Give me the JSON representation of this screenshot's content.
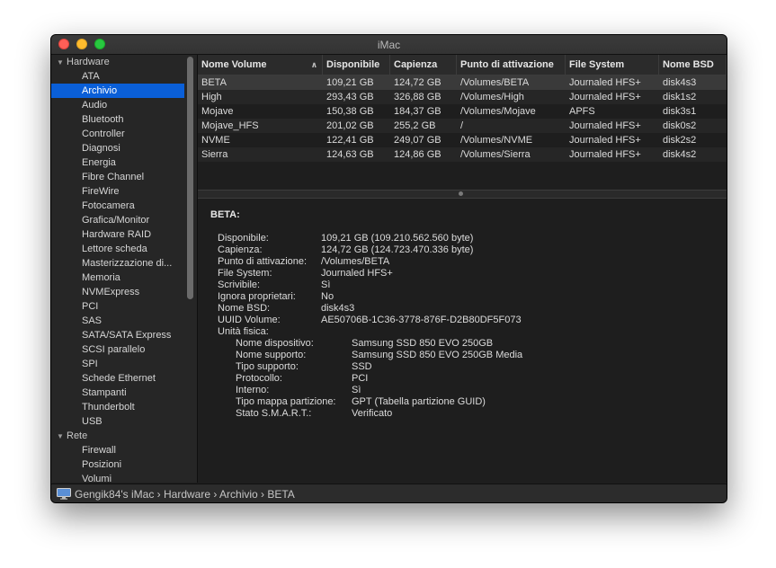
{
  "window": {
    "title": "iMac"
  },
  "sidebar": {
    "groups": [
      {
        "label": "Hardware",
        "items": [
          "ATA",
          "Archivio",
          "Audio",
          "Bluetooth",
          "Controller",
          "Diagnosi",
          "Energia",
          "Fibre Channel",
          "FireWire",
          "Fotocamera",
          "Grafica/Monitor",
          "Hardware RAID",
          "Lettore scheda",
          "Masterizzazione di...",
          "Memoria",
          "NVMExpress",
          "PCI",
          "SAS",
          "SATA/SATA Express",
          "SCSI parallelo",
          "SPI",
          "Schede Ethernet",
          "Stampanti",
          "Thunderbolt",
          "USB"
        ]
      },
      {
        "label": "Rete",
        "items": [
          "Firewall",
          "Posizioni",
          "Volumi"
        ]
      }
    ],
    "selected": "Archivio"
  },
  "table": {
    "columns": [
      "Nome Volume",
      "Disponibile",
      "Capienza",
      "Punto di attivazione",
      "File System",
      "Nome BSD"
    ],
    "rows": [
      [
        "BETA",
        "109,21 GB",
        "124,72 GB",
        "/Volumes/BETA",
        "Journaled HFS+",
        "disk4s3"
      ],
      [
        "High",
        "293,43 GB",
        "326,88 GB",
        "/Volumes/High",
        "Journaled HFS+",
        "disk1s2"
      ],
      [
        "Mojave",
        "150,38 GB",
        "184,37 GB",
        "/Volumes/Mojave",
        "APFS",
        "disk3s1"
      ],
      [
        "Mojave_HFS",
        "201,02 GB",
        "255,2 GB",
        "/",
        "Journaled HFS+",
        "disk0s2"
      ],
      [
        "NVME",
        "122,41 GB",
        "249,07 GB",
        "/Volumes/NVME",
        "Journaled HFS+",
        "disk2s2"
      ],
      [
        "Sierra",
        "124,63 GB",
        "124,86 GB",
        "/Volumes/Sierra",
        "Journaled HFS+",
        "disk4s2"
      ]
    ],
    "selected_row": 0
  },
  "detail": {
    "title": "BETA:",
    "fields": [
      [
        "Disponibile:",
        "109,21 GB (109.210.562.560 byte)"
      ],
      [
        "Capienza:",
        "124,72 GB (124.723.470.336 byte)"
      ],
      [
        "Punto di attivazione:",
        "/Volumes/BETA"
      ],
      [
        "File System:",
        "Journaled HFS+"
      ],
      [
        "Scrivibile:",
        "Sì"
      ],
      [
        "Ignora proprietari:",
        "No"
      ],
      [
        "Nome BSD:",
        "disk4s3"
      ],
      [
        "UUID Volume:",
        "AE50706B-1C36-3778-876F-D2B80DF5F073"
      ],
      [
        "Unità fisica:",
        ""
      ]
    ],
    "physical": [
      [
        "Nome dispositivo:",
        "Samsung SSD 850 EVO 250GB"
      ],
      [
        "Nome supporto:",
        "Samsung SSD 850 EVO 250GB Media"
      ],
      [
        "Tipo supporto:",
        "SSD"
      ],
      [
        "Protocollo:",
        "PCI"
      ],
      [
        "Interno:",
        "Sì"
      ],
      [
        "Tipo mappa partizione:",
        "GPT (Tabella partizione GUID)"
      ],
      [
        "Stato S.M.A.R.T.:",
        "Verificato"
      ]
    ]
  },
  "statusbar": {
    "path": "Gengik84's iMac › Hardware › Archivio › BETA"
  },
  "colors": {
    "selection": "#0a5fd8",
    "background": "#1e1e1e"
  }
}
